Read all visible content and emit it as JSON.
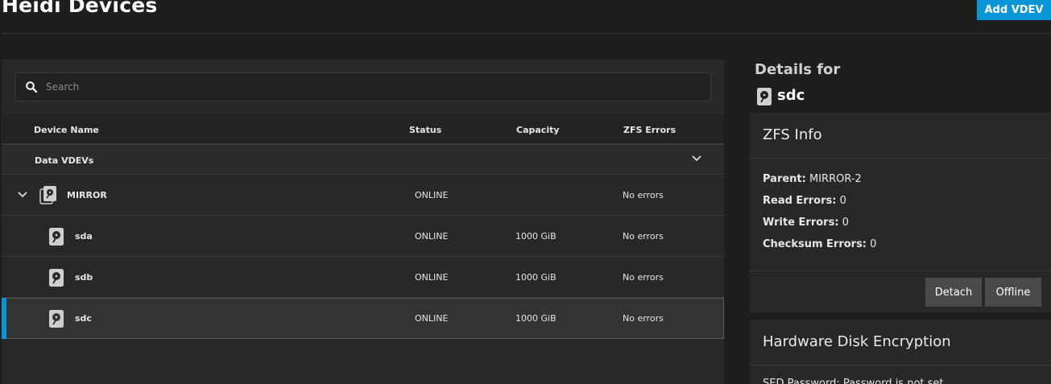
{
  "header": {
    "title": "Heidi Devices",
    "add_vdev_label": "Add VDEV"
  },
  "search": {
    "placeholder": "Search"
  },
  "table": {
    "columns": [
      "Device Name",
      "Status",
      "Capacity",
      "ZFS Errors"
    ],
    "group_label": "Data VDEVs",
    "rows": [
      {
        "name": "MIRROR",
        "status": "ONLINE",
        "capacity": "",
        "errors": "No errors"
      },
      {
        "name": "sda",
        "status": "ONLINE",
        "capacity": "1000 GiB",
        "errors": "No errors"
      },
      {
        "name": "sdb",
        "status": "ONLINE",
        "capacity": "1000 GiB",
        "errors": "No errors"
      },
      {
        "name": "sdc",
        "status": "ONLINE",
        "capacity": "1000 GiB",
        "errors": "No errors"
      }
    ]
  },
  "details": {
    "title": "Details for",
    "disk_name": "sdc",
    "zfs_info": {
      "title": "ZFS Info",
      "parent_label": "Parent:",
      "parent_value": "MIRROR-2",
      "read_label": "Read Errors:",
      "read_value": "0",
      "write_label": "Write Errors:",
      "write_value": "0",
      "checksum_label": "Checksum Errors:",
      "checksum_value": "0",
      "detach_label": "Detach",
      "offline_label": "Offline"
    },
    "hardware": {
      "title": "Hardware Disk Encryption",
      "partial_text": "SED Password: Password is not set"
    }
  },
  "colors": {
    "accent": "#0a95d8",
    "background": "#1e1e1e",
    "panel": "#282828"
  },
  "icons": {
    "search": "search-icon",
    "disk": "hard-disk-icon",
    "vdev": "vdev-stack-icon",
    "chevron": "chevron-down-icon"
  }
}
